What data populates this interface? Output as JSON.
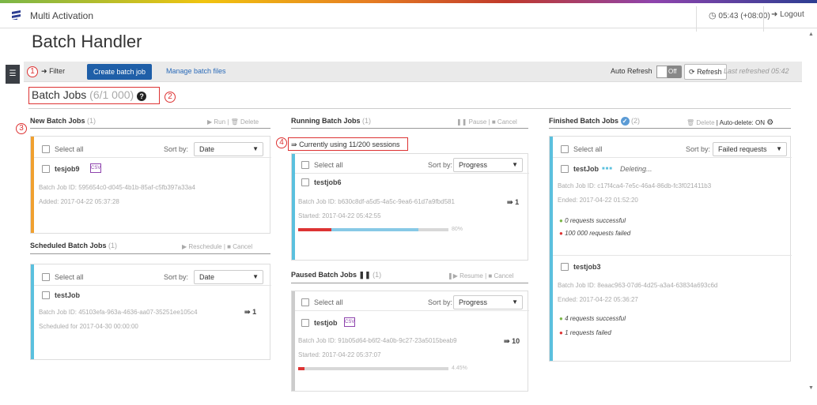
{
  "app": {
    "title": "Multi Activation",
    "time": "05:43 (+08:00)",
    "logout": "Logout"
  },
  "page": {
    "title": "Batch Handler"
  },
  "toolbar": {
    "filter": "Filter",
    "create": "Create batch job",
    "manage": "Manage batch files",
    "auto_refresh": "Auto Refresh",
    "toggle": "Off",
    "refresh": "Refresh",
    "last_refreshed": "Last refreshed 05:42"
  },
  "callouts": [
    "1",
    "2",
    "3",
    "4"
  ],
  "batch_jobs": {
    "title": "Batch Jobs",
    "count": "(6/1 000)"
  },
  "new_jobs": {
    "title": "New Batch Jobs",
    "count": "(1)",
    "run": "Run",
    "delete": "Delete",
    "select_all": "Select all",
    "sort_label": "Sort by:",
    "sort_value": "Date",
    "job": {
      "name": "tesjob9",
      "id": "Batch Job ID: 595654c0-d045-4b1b-85af-c5fb397a33a4",
      "added": "Added: 2017-04-22 05:37:28"
    }
  },
  "scheduled_jobs": {
    "title": "Scheduled Batch Jobs",
    "count": "(1)",
    "reschedule": "Reschedule",
    "cancel": "Cancel",
    "select_all": "Select all",
    "sort_label": "Sort by:",
    "sort_value": "Date",
    "job": {
      "name": "testJob",
      "id": "Batch Job ID: 45103efa-963a-4636-aa07-35251ee105c4",
      "scheduled": "Scheduled for 2017-04-30 00:00:00",
      "sessions": "1"
    }
  },
  "running_jobs": {
    "title": "Running Batch Jobs",
    "count": "(1)",
    "pause": "Pause",
    "cancel": "Cancel",
    "sessions_note": "Currently using 11/200 sessions",
    "select_all": "Select all",
    "sort_label": "Sort by:",
    "sort_value": "Progress",
    "job": {
      "name": "testjob6",
      "id": "Batch Job ID: b630c8df-a5d5-4a5c-9ea6-61d7a9fbd581",
      "started": "Started: 2017-04-22 05:42:55",
      "sessions": "1",
      "progress_failed": 0.22,
      "progress_total": 0.8,
      "progress_label": "80%"
    }
  },
  "paused_jobs": {
    "title": "Paused Batch Jobs",
    "count": "(1)",
    "resume": "Resume",
    "cancel": "Cancel",
    "select_all": "Select all",
    "sort_label": "Sort by:",
    "sort_value": "Progress",
    "job": {
      "name": "testjob",
      "id": "Batch Job ID: 91b05d64-b6f2-4a0b-9c27-23a5015beab9",
      "started": "Started: 2017-04-22 05:37:07",
      "sessions": "10",
      "progress_failed": 0.04,
      "progress_total": 0.04,
      "progress_label": "4.45%"
    }
  },
  "finished_jobs": {
    "title": "Finished Batch Jobs",
    "count": "(2)",
    "delete": "Delete",
    "auto_delete": "Auto-delete: ON",
    "select_all": "Select all",
    "sort_label": "Sort by:",
    "sort_value": "Failed requests",
    "jobs": [
      {
        "name": "testJob",
        "status": "Deleting...",
        "id": "Batch Job ID: c17f4ca4-7e5c-46a4-86db-fc3f021411b3",
        "ended": "Ended: 2017-04-22 01:52:20",
        "success": "0 requests successful",
        "failed": "100 000 requests failed"
      },
      {
        "name": "testjob3",
        "id": "Batch Job ID: 8eaac963-07d6-4d25-a3a4-63834a693c6d",
        "ended": "Ended: 2017-04-22 05:36:27",
        "success": "4 requests successful",
        "failed": "1 requests failed"
      }
    ]
  },
  "colors": {
    "new": "#f0a030",
    "scheduled": "#5bc0de",
    "running": "#5bc0de",
    "paused": "#cccccc",
    "finished": "#5bc0de",
    "primary": "#1f5fa8",
    "callout": "#dd3333"
  }
}
